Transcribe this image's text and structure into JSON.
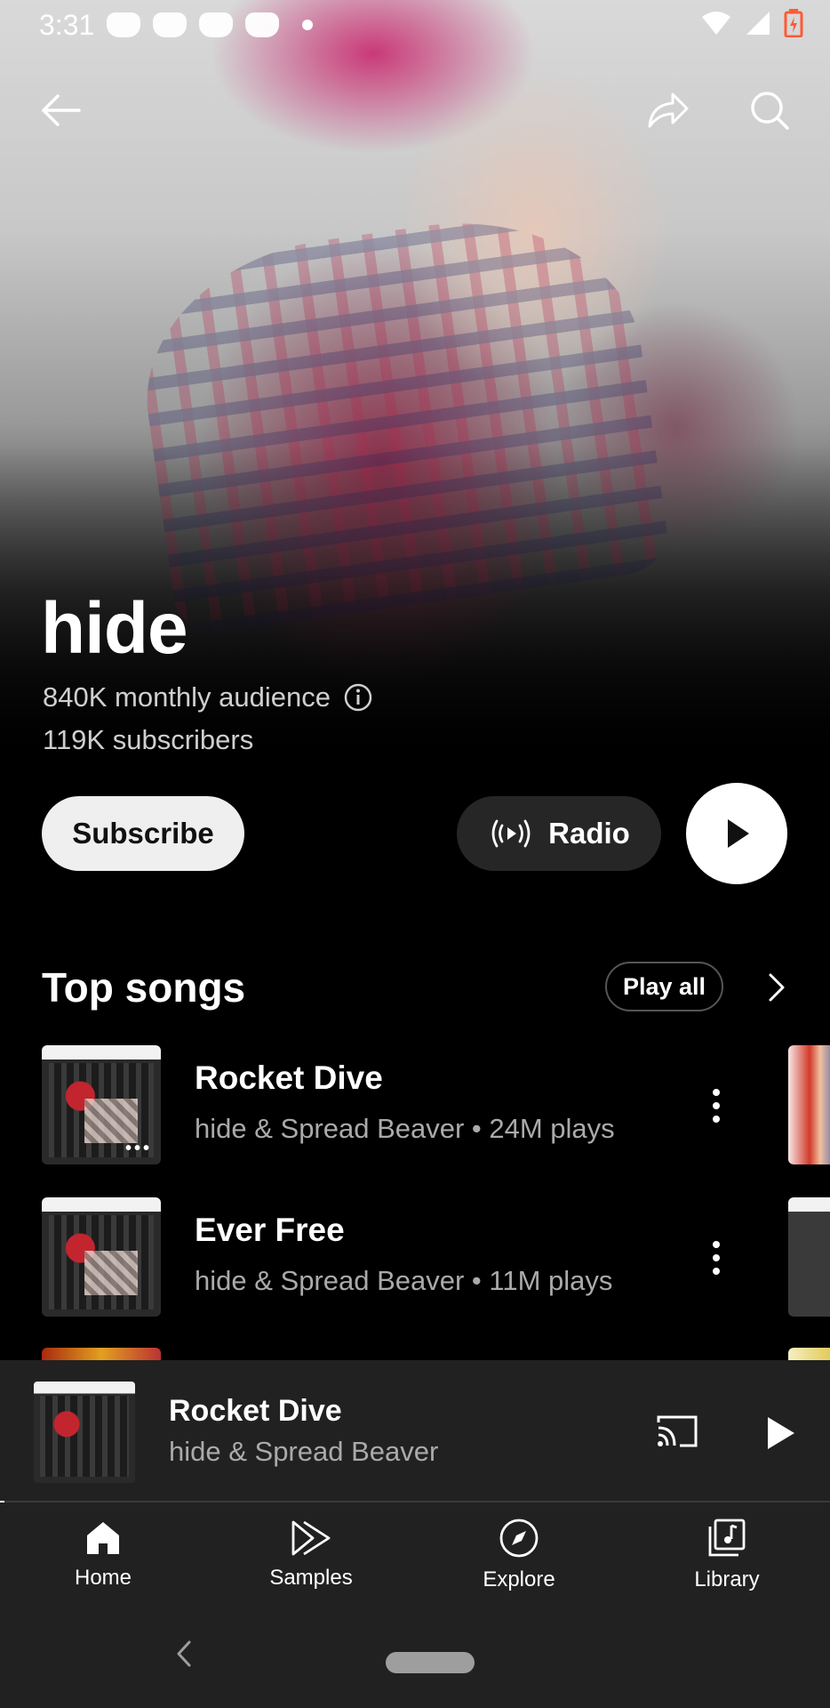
{
  "status_bar": {
    "time": "3:31"
  },
  "header": {
    "back_icon": "arrow-left-icon",
    "share_icon": "share-arrow-icon",
    "search_icon": "search-icon"
  },
  "artist": {
    "name": "hide",
    "monthly_audience": "840K monthly audience",
    "subscribers": "119K subscribers"
  },
  "actions": {
    "subscribe_label": "Subscribe",
    "radio_label": "Radio"
  },
  "top_songs": {
    "title": "Top songs",
    "play_all_label": "Play all",
    "songs": [
      {
        "title": "Rocket Dive",
        "subtitle": "hide & Spread Beaver • 24M plays"
      },
      {
        "title": "Ever Free",
        "subtitle": "hide & Spread Beaver • 11M plays"
      }
    ]
  },
  "mini_player": {
    "title": "Rocket Dive",
    "artist": "hide & Spread Beaver",
    "progress": 0.005
  },
  "bottom_nav": {
    "items": [
      {
        "label": "Home",
        "icon": "home-icon",
        "active": true
      },
      {
        "label": "Samples",
        "icon": "samples-icon",
        "active": false
      },
      {
        "label": "Explore",
        "icon": "compass-icon",
        "active": false
      },
      {
        "label": "Library",
        "icon": "library-icon",
        "active": false
      }
    ]
  },
  "colors": {
    "background": "#000000",
    "surface": "#212121",
    "subtext": "#aaaaaa",
    "battery": "#ff5a36"
  }
}
